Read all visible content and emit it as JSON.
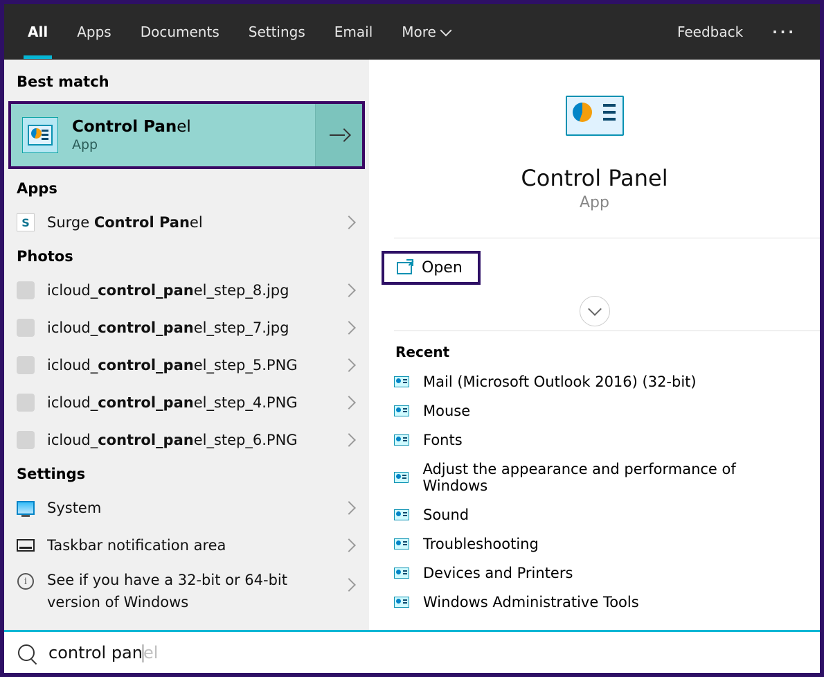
{
  "tabs": {
    "items": [
      "All",
      "Apps",
      "Documents",
      "Settings",
      "Email",
      "More"
    ],
    "activeIndex": 0,
    "feedback": "Feedback"
  },
  "left": {
    "bestMatchHeader": "Best match",
    "bestMatch": {
      "titleBold": "Control Pan",
      "titleRest": "el",
      "subtitle": "App"
    },
    "appsHeader": "Apps",
    "apps": [
      {
        "pre": "Surge ",
        "bold": "Control Pan",
        "post": "el"
      }
    ],
    "photosHeader": "Photos",
    "photos": [
      {
        "pre": "icloud_",
        "bold": "control_pan",
        "post": "el_step_8.jpg"
      },
      {
        "pre": "icloud_",
        "bold": "control_pan",
        "post": "el_step_7.jpg"
      },
      {
        "pre": "icloud_",
        "bold": "control_pan",
        "post": "el_step_5.PNG"
      },
      {
        "pre": "icloud_",
        "bold": "control_pan",
        "post": "el_step_4.PNG"
      },
      {
        "pre": "icloud_",
        "bold": "control_pan",
        "post": "el_step_6.PNG"
      }
    ],
    "settingsHeader": "Settings",
    "settings": [
      {
        "label": "System",
        "icon": "monitor"
      },
      {
        "label": "Taskbar notification area",
        "icon": "taskbar"
      },
      {
        "label": "See if you have a 32-bit or 64-bit version of Windows",
        "icon": "info"
      }
    ]
  },
  "right": {
    "title": "Control Panel",
    "subtitle": "App",
    "openLabel": "Open",
    "recentHeader": "Recent",
    "recent": [
      "Mail (Microsoft Outlook 2016) (32-bit)",
      "Mouse",
      "Fonts",
      "Adjust the appearance and performance of Windows",
      "Sound",
      "Troubleshooting",
      "Devices and Printers",
      "Windows Administrative Tools"
    ]
  },
  "search": {
    "typed": "control pan",
    "suggestRest": "el"
  }
}
